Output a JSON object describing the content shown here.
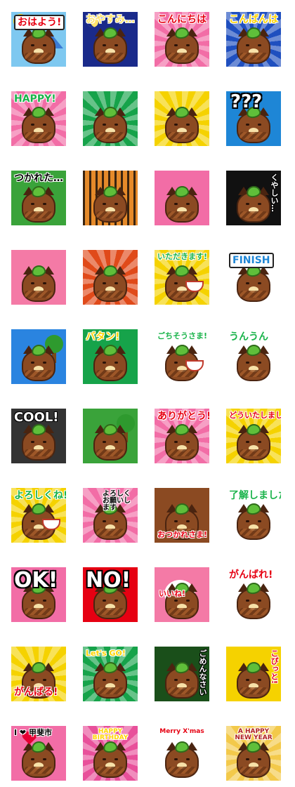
{
  "title": "",
  "colors": {
    "cat_body": "#8b4a22",
    "leaf": "#5fbf3a"
  },
  "tiles": [
    {
      "id": "ohayo",
      "label": "おはよう!",
      "bg": "#7ec8f0",
      "label_color": "#e60012",
      "scene": "sun"
    },
    {
      "id": "oyasumi",
      "label": "おやすみ…",
      "bg": "#1a2a8a",
      "label_color": "#ffe36b",
      "scene": "moon"
    },
    {
      "id": "konnichiwa",
      "label": "こんにちは",
      "bg": "#f26da6",
      "label_color": "#e60012",
      "scene": "rays"
    },
    {
      "id": "konbanwa",
      "label": "こんばんは",
      "bg": "#1f4fbf",
      "label_color": "#ffd400",
      "scene": "rays"
    },
    {
      "id": "happy",
      "label": "HAPPY!",
      "bg": "#f26da6",
      "label_color": "#19b34a",
      "scene": "stars"
    },
    {
      "id": "blank-green",
      "label": "",
      "bg": "#16a34a",
      "label_color": "#000",
      "scene": "rays"
    },
    {
      "id": "blank-yellow",
      "label": "",
      "bg": "#f5d200",
      "label_color": "#000",
      "scene": "rays"
    },
    {
      "id": "question",
      "label": "???",
      "bg": "#1e86d6",
      "label_color": "#ffffff",
      "scene": "none"
    },
    {
      "id": "tsukareta",
      "label": "つかれた…",
      "bg": "#3aa33a",
      "label_color": "#000",
      "scene": "none"
    },
    {
      "id": "blank-stripes",
      "label": "",
      "bg": "#e58a2a",
      "label_color": "#000",
      "scene": "stripes"
    },
    {
      "id": "blank-pink",
      "label": "",
      "bg": "#f26da6",
      "label_color": "#000",
      "scene": "none"
    },
    {
      "id": "kuyashii",
      "label": "くやしい…",
      "bg": "#111111",
      "label_color": "#ffffff",
      "scene": "vertical"
    },
    {
      "id": "blank-pink2",
      "label": "",
      "bg": "#f47aa6",
      "label_color": "#000",
      "scene": "none"
    },
    {
      "id": "blank-festival",
      "label": "",
      "bg": "#e04a1a",
      "label_color": "#000",
      "scene": "stars"
    },
    {
      "id": "itadakimasu",
      "label": "いただきます!",
      "bg": "#f5d200",
      "label_color": "#19b34a",
      "scene": "rays"
    },
    {
      "id": "finish",
      "label": "FINISH",
      "bg": "#ffffff",
      "label_color": "#1e86d6",
      "scene": "none"
    },
    {
      "id": "blank-hiker",
      "label": "",
      "bg": "#2a84e0",
      "label_color": "#000",
      "scene": "tree"
    },
    {
      "id": "batan",
      "label": "バタン!",
      "bg": "#16a34a",
      "label_color": "#ffd400",
      "scene": "none"
    },
    {
      "id": "gochisousama",
      "label": "ごちそうさま!",
      "bg": "#ffffff",
      "label_color": "#19b34a",
      "scene": "none"
    },
    {
      "id": "unun",
      "label": "うんうん",
      "bg": "#ffffff",
      "label_color": "#19b34a",
      "scene": "none"
    },
    {
      "id": "cool",
      "label": "COOL!",
      "bg": "#333333",
      "label_color": "#ffffff",
      "scene": "none"
    },
    {
      "id": "blank-forest",
      "label": "",
      "bg": "#3aa33a",
      "label_color": "#000",
      "scene": "tree"
    },
    {
      "id": "arigatou",
      "label": "ありがとう!",
      "bg": "#f26da6",
      "label_color": "#e60012",
      "scene": "rays"
    },
    {
      "id": "douitashimashite",
      "label": "どういたしまして",
      "bg": "#f5d200",
      "label_color": "#e60012",
      "scene": "rays"
    },
    {
      "id": "yoroshikune",
      "label": "よろしくね!",
      "bg": "#f5d200",
      "label_color": "#19b34a",
      "scene": "rays"
    },
    {
      "id": "yoroshiku-onegai",
      "label": "よろしくお願いします",
      "bg": "#f26da6",
      "label_color": "#000",
      "scene": "rays"
    },
    {
      "id": "otsukaresama",
      "label": "おつかれさま!",
      "bg": "#8b4a22",
      "label_color": "#e60012",
      "scene": "none"
    },
    {
      "id": "ryoukai",
      "label": "了解しました",
      "bg": "#ffffff",
      "label_color": "#19b34a",
      "scene": "none"
    },
    {
      "id": "ok",
      "label": "OK!",
      "bg": "#f26da6",
      "label_color": "#ffffff",
      "scene": "none"
    },
    {
      "id": "no",
      "label": "NO!",
      "bg": "#e60012",
      "label_color": "#ffffff",
      "scene": "none"
    },
    {
      "id": "iine",
      "label": "いいね!",
      "bg": "#f47aa6",
      "label_color": "#e60012",
      "scene": "paw"
    },
    {
      "id": "ganbare",
      "label": "がんばれ!",
      "bg": "#ffffff",
      "label_color": "#e60012",
      "scene": "none"
    },
    {
      "id": "ganbaru",
      "label": "がんばる!",
      "bg": "#f5d200",
      "label_color": "#e60012",
      "scene": "rays"
    },
    {
      "id": "lets-go",
      "label": "Let's GO!",
      "bg": "#16a34a",
      "label_color": "#ffd400",
      "scene": "rays"
    },
    {
      "id": "gomennasai",
      "label": "ごめんなさい",
      "bg": "#1a4f1a",
      "label_color": "#ffffff",
      "scene": "vertical"
    },
    {
      "id": "kopitto",
      "label": "こぴっと!",
      "bg": "#f5d200",
      "label_color": "#e60012",
      "scene": "vertical"
    },
    {
      "id": "i-love-kofu",
      "label": "I ❤ 甲斐市",
      "bg": "#f26da6",
      "label_color": "#000",
      "scene": "none"
    },
    {
      "id": "happy-birthday",
      "label": "HAPPY BIRTHDAY",
      "bg": "#e8509a",
      "label_color": "#ffd400",
      "scene": "rays"
    },
    {
      "id": "merry-xmas",
      "label": "Merry X'mas",
      "bg": "#ffffff",
      "label_color": "#e60012",
      "scene": "none"
    },
    {
      "id": "happy-new-year",
      "label": "A HAPPY NEW YEAR",
      "bg": "#f3c94a",
      "label_color": "#b02020",
      "scene": "rays"
    }
  ]
}
